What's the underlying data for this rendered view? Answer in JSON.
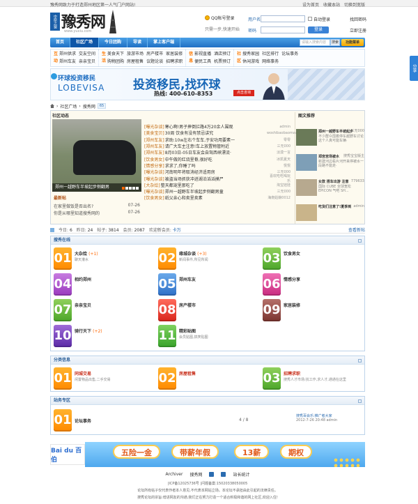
{
  "topbar": {
    "tagline": "豫秀网致力于打造郑州地区第一人气门户网站!",
    "links": [
      "设为首页",
      "收藏本站",
      "切换到宽版"
    ]
  },
  "header": {
    "logo_text": "豫秀网",
    "logo_sub": "www.yuxiu.com",
    "logo_stamp": "中原之窗",
    "qq_login": "QQ帐号登录",
    "qq_sub": "只需一步,快速开始",
    "login": {
      "user_label": "用户名",
      "pass_label": "密码",
      "remember": "自动登录",
      "submit": "登录",
      "forgot": "找回密码",
      "register": "立即注册"
    }
  },
  "nav": {
    "items": [
      "首页",
      "社区广场",
      "今日团购",
      "导读",
      "掌上客户端"
    ],
    "search_placeholder": "请输入搜索内容",
    "search_btn": "搜索",
    "func_btn": "功能菜单"
  },
  "sublinks": [
    {
      "head": "互动",
      "links": [
        "郑州供求",
        "交友空间",
        "郑州车友",
        "亲亲宝贝"
      ],
      "cols": 2
    },
    {
      "head": "生活",
      "links": [
        "美食天下",
        "旅游市场",
        "房产楼市",
        "家居装修",
        "购物团购",
        "房屋租售",
        "议题论谈",
        "招聘求职"
      ],
      "cols": 4
    },
    {
      "head": "信息",
      "links": [
        "影视直播",
        "酒店预订",
        "便民工具",
        "机票预订"
      ],
      "cols": 2
    },
    {
      "head": "社区",
      "links": [
        "搜秀家园",
        "社区排行",
        "论坛事务",
        "休闲游戏",
        "网络事务"
      ],
      "cols": 3
    }
  ],
  "banner": {
    "brand": "环球投资移民",
    "brand_en": "LOBEVISA",
    "slogan": "投资移民,找环球",
    "hotline": "热线: 400-610-8353",
    "consult": "点击咨询"
  },
  "breadcrumb": {
    "items": [
      "社区广场",
      "搜秀网"
    ],
    "badge": "65"
  },
  "community": {
    "title": "社区动态",
    "photo_caption": "郑州一越野车半坡起步侧翻男",
    "hot_title": "最新帖",
    "side_items": [
      {
        "t": "在家里做饭是否出名?",
        "d": "07-26"
      },
      {
        "t": "你是从哪里知道搜秀网的",
        "d": "07-26"
      }
    ],
    "list": [
      {
        "tag": "[曝光杂谈]",
        "t": "寒心啊!男子摔倒拦路4万20余人围观",
        "a": "admin"
      },
      {
        "tag": "[美食宝贝]",
        "t": "30周 饮食有没有禁忌讲究",
        "a": "woshibaobaomaA"
      },
      {
        "tag": "[郑州车友]",
        "t": "求助:10w左右个车车,于安功用要素一",
        "a": "零零"
      },
      {
        "tag": "[郑州车友]",
        "t": "请广大车主注意!车上放置物管附近",
        "a": "三无000"
      },
      {
        "tag": "[郑州车友]",
        "t": "8月03日-05日车友会自驾西峡漂流·",
        "a": "淡漠一言"
      },
      {
        "tag": "[饮食男女]",
        "t": "中午做的红烧里脊,很好吃",
        "a": "冰凯夏天"
      },
      {
        "tag": "[情感分享]",
        "t": "求求了,你睡了吗",
        "a": "悦悦"
      },
      {
        "tag": "[曝光杂谈]",
        "t": "河南明年将取消经济适用房",
        "a": "三无000"
      },
      {
        "tag": "[曝光杂谈]",
        "t": "被盗当场抓获冲进湖泊滔滔摸尸",
        "a": "喜欢吃吃喝玩乐"
      },
      {
        "tag": "[大杂烩]",
        "t": "整天都宠里那吃了",
        "a": "淘宝娃娃"
      },
      {
        "tag": "[曝光杂谈]",
        "t": "郑州一越野车半坡起步侧翻男童",
        "a": "三无000"
      },
      {
        "tag": "[饮食男女]",
        "t": "纸父亲心和卖里卖素",
        "a": "海南姑娘0012"
      }
    ],
    "pic_title": "图文推荐",
    "cards": [
      {
        "t": "郑州一越野车半坡起步",
        "d": "不少群众围着停车越野车讨论这个人真可能车辆·"
      },
      {
        "t": "郑宫宫场被水",
        "d": "新建河边看片河开来停被水一段路不能走·"
      },
      {
        "t": "女款 搭车出游 注意",
        "d": "国际 CUBE 全球宽松 EPICON 气吧 SH..."
      },
      {
        "t": "吃货们注意了!夏季到",
        "d": ""
      }
    ],
    "card_authors": [
      "三无000",
      "搜秀宝宝版主",
      "779633",
      "admin"
    ]
  },
  "stats": {
    "today_label": "今日:",
    "today": "6",
    "yesterday_label": "昨日:",
    "yesterday": "24",
    "posts_label": "帖子:",
    "posts": "3814",
    "members_label": "会员:",
    "members": "2087",
    "welcome_label": "欢迎新会员:",
    "welcome": "卡万",
    "more": "查看新帖"
  },
  "section1": {
    "title": "搜秀在线",
    "boards": [
      {
        "n": "01",
        "name": "大杂烩",
        "cnt": "(+1)",
        "desc": "聊天灌水",
        "color": "orange"
      },
      {
        "n": "02",
        "name": "缘城杂谈",
        "cnt": "(+3)",
        "desc": "新闻事件,所见所闻",
        "color": "orange"
      },
      {
        "n": "03",
        "name": "饮食男女",
        "cnt": "",
        "desc": "",
        "color": "green"
      },
      {
        "n": "04",
        "name": "相约郑州",
        "cnt": "",
        "desc": "",
        "color": "purple"
      },
      {
        "n": "05",
        "name": "郑州车友",
        "cnt": "",
        "desc": "",
        "color": "blue"
      },
      {
        "n": "06",
        "name": "情感分享",
        "cnt": "",
        "desc": "",
        "color": "pink"
      },
      {
        "n": "07",
        "name": "亲亲宝贝",
        "cnt": "",
        "desc": "",
        "color": "green"
      },
      {
        "n": "08",
        "name": "房产楼市",
        "cnt": "",
        "desc": "",
        "color": "red"
      },
      {
        "n": "09",
        "name": "家居装修",
        "cnt": "",
        "desc": "",
        "color": "brown"
      },
      {
        "n": "10",
        "name": "骑行天下",
        "cnt": "(+2)",
        "desc": "",
        "color": "violet"
      },
      {
        "n": "11",
        "name": "精彩贴图",
        "cnt": "",
        "desc": "会员贴图,搞笑贴图",
        "color": "lime"
      }
    ]
  },
  "section2": {
    "title": "分类信息",
    "boards": [
      {
        "n": "01",
        "name": "同城交易",
        "desc": "闲置物品出售,二手交易",
        "color": "orange"
      },
      {
        "n": "02",
        "name": "房屋租售",
        "desc": "",
        "color": "orange"
      },
      {
        "n": "03",
        "name": "招聘求职",
        "desc": "搜秀人才市场:找工作,求人才,通通在这里",
        "color": "green"
      }
    ]
  },
  "section3": {
    "title": "站务专区",
    "board": {
      "n": "01",
      "name": "论坛事务",
      "color": "orange"
    },
    "count": "4 / 8",
    "latest": "搜秀百会乐:推广者大家",
    "latest_time": "2012-7-26 20:48 admin"
  },
  "footer": {
    "baidu": "Bai du 百伯",
    "ribbons": [
      "五险一金",
      "带薪年假",
      "13薪",
      "期权"
    ],
    "links": [
      "Archiver",
      "搜秀网",
      "站长统计"
    ],
    "icp": "|ICP备12025736号  |问题备案:15020338050005",
    "notice": "论坛所有帖子仅代表作者本人意见,不代表本网站立场。本论坛不承担由此引起的法律责任。",
    "notice2": "搜秀论坛的宗旨:增进网友的沟通,我们正在努力打造一个适合积极和谐的网上社区,欢迎入住!"
  },
  "share": "分享"
}
